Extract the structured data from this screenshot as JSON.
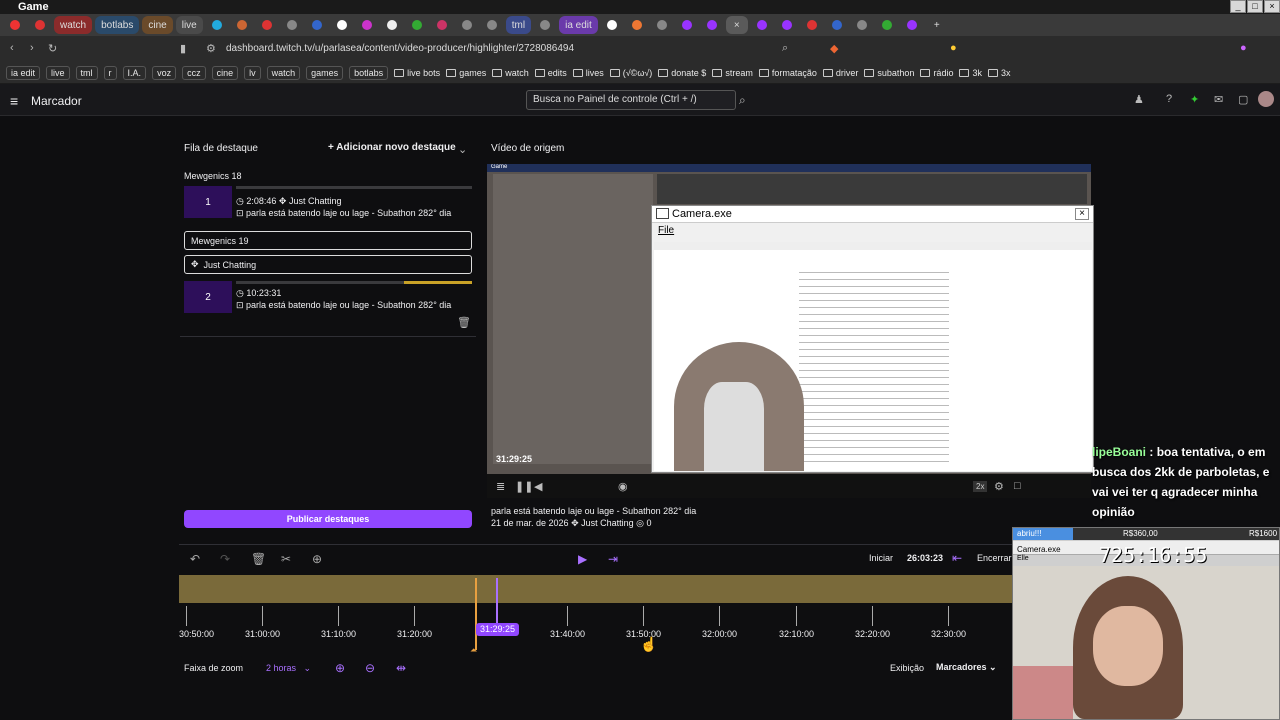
{
  "window": {
    "title": "Game"
  },
  "tabs": [
    {
      "label": "watch"
    },
    {
      "label": "botlabs"
    },
    {
      "label": "cine"
    },
    {
      "label": "live"
    },
    {
      "label": "tml"
    },
    {
      "label": "ia edit"
    }
  ],
  "address": {
    "url": "dashboard.twitch.tv/u/parlasea/content/video-producer/highlighter/2728086494"
  },
  "bookmarks": {
    "tags": [
      "ia edit",
      "live",
      "tml",
      "r",
      "I.A.",
      "voz",
      "ccz",
      "cine",
      "lv",
      "watch",
      "games",
      "botlabs"
    ],
    "folders": [
      "live bots",
      "games",
      "watch",
      "edits",
      "lives",
      "(√©ω√)",
      "donate $",
      "stream",
      "formatação",
      "driver",
      "subathon",
      "rádio",
      "3k",
      "3x"
    ]
  },
  "header": {
    "title": "Marcador",
    "search_placeholder": "Busca no Painel de controle (Ctrl + /)"
  },
  "queue": {
    "title": "Fila de destaque",
    "add_label": "Adicionar novo destaque",
    "items": [
      {
        "group": "Mewgenics 18",
        "num": "1",
        "duration": "2:08:46",
        "category": "Just Chatting",
        "desc": "parla está batendo laje ou lage - Subathon 282° dia"
      },
      {
        "group": "Mewgenics 19",
        "num": "2",
        "duration": "10:23:31",
        "category": "Just Chatting",
        "desc": "parla está batendo laje ou lage - Subathon 282° dia"
      }
    ],
    "publish_label": "Publicar destaques"
  },
  "source": {
    "title": "Vídeo de origem",
    "timestamp": "31:29:25",
    "video_title": "parla está batendo laje ou lage - Subathon 282° dia",
    "date": "21 de mar. de 2026",
    "category": "Just Chatting",
    "views": "0",
    "speed": "2x",
    "camera_title": "Camera.exe",
    "camera_menu": "File",
    "game_label": "Game"
  },
  "chat_overlay": {
    "user": "lipeBoani",
    "message": ": boa tentativa, o em busca dos 2kk de parboletas, e vai vei ter q agradecer minha opinião"
  },
  "webcam": {
    "user": "abriu!!!",
    "left_amount": "R$360,00",
    "right_amount": "R$1600",
    "clock": "725:16:55",
    "cam_title": "Camera.exe",
    "cam_menu": "Elle"
  },
  "editor": {
    "start_label": "Iniciar",
    "start_time": "26:03:23",
    "end_label": "Encerrar",
    "playhead": "31:29:25",
    "ticks": [
      "30:50:00",
      "31:00:00",
      "31:10:00",
      "31:20:00",
      "31:40:00",
      "31:50:00",
      "32:00:00",
      "32:10:00",
      "32:20:00",
      "32:30:00"
    ],
    "zoom_label": "Faixa de zoom",
    "zoom_value": "2 horas",
    "view_label": "Exibição",
    "view_value": "Marcadores"
  },
  "colors": {
    "accent": "#9147ff",
    "bg": "#0e0e10",
    "timeline": "#7a6a3a"
  }
}
